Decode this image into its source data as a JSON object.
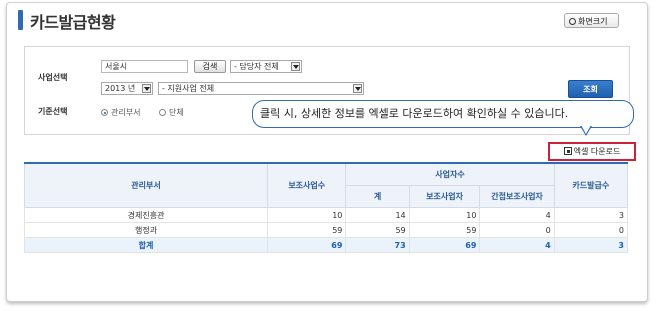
{
  "header": {
    "title": "카드발급현황",
    "zoom_label": "화면크기"
  },
  "filters": {
    "business_label": "사업선택",
    "criteria_label": "기준선택",
    "region_value": "서울시",
    "search_small_label": "검색",
    "manager_select": "- 담당자 전체",
    "year_select": "2013 년",
    "program_select": "- 지원사업 전체",
    "search_label": "조회",
    "radio_options": [
      "관리부서",
      "단체"
    ],
    "radio_selected": "관리부서"
  },
  "tooltip": {
    "text": "클릭 시, 상세한 정보를 엑셀로 다운로드하여 확인하실 수 있습니다."
  },
  "excel_download_label": "엑셀 다운로드",
  "table": {
    "headers": {
      "dept": "관리부서",
      "subsidy_projects": "보조사업수",
      "operators": "사업자수",
      "total": "계",
      "subsidy_operators": "보조사업자",
      "indirect_operators": "간접보조사업자",
      "cards_issued": "카드발급수"
    },
    "rows": [
      {
        "dept": "경제진흥관",
        "subsidy_projects": "10",
        "total": "14",
        "subsidy_operators": "10",
        "indirect_operators": "4",
        "cards_issued": "3"
      },
      {
        "dept": "행정과",
        "subsidy_projects": "59",
        "total": "59",
        "subsidy_operators": "59",
        "indirect_operators": "0",
        "cards_issued": "0"
      }
    ],
    "total_row": {
      "dept": "합계",
      "subsidy_projects": "69",
      "total": "73",
      "subsidy_operators": "69",
      "indirect_operators": "4",
      "cards_issued": "3"
    }
  },
  "colors": {
    "accent": "#2f6ab3",
    "highlight": "#d0213b"
  }
}
